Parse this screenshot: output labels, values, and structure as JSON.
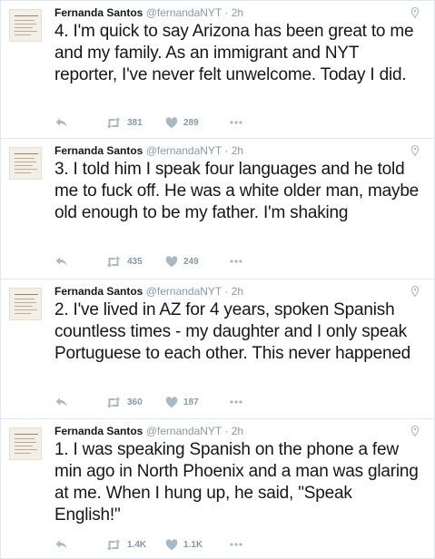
{
  "tweets": [
    {
      "name": "Fernanda Santos",
      "handle": "@fernandaNYT",
      "time": "· 2h",
      "text": "4. I'm quick to say Arizona has been great to me and my family. As an immigrant and NYT reporter, I've never felt unwelcome. Today I did.",
      "retweets": "381",
      "likes": "289"
    },
    {
      "name": "Fernanda Santos",
      "handle": "@fernandaNYT",
      "time": "· 2h",
      "text": "3. I told him I speak four languages and he told me to fuck off. He was a white older man, maybe old enough to be my father. I'm shaking",
      "retweets": "435",
      "likes": "249"
    },
    {
      "name": "Fernanda Santos",
      "handle": "@fernandaNYT",
      "time": "· 2h",
      "text": "2. I've lived in AZ for 4 years, spoken Spanish countless times - my daughter and I only speak Portuguese to each other. This never happened",
      "retweets": "360",
      "likes": "187"
    },
    {
      "name": "Fernanda Santos",
      "handle": "@fernandaNYT",
      "time": "· 2h",
      "text": "1. I was speaking Spanish on the phone a few min ago in North Phoenix and a man was glaring at me. When I hung up, he said, \"Speak English!\"",
      "retweets": "1.4K",
      "likes": "1.1K"
    }
  ],
  "icons": {
    "reply": "reply-icon",
    "retweet": "retweet-icon",
    "like": "heart-icon",
    "more": "more-icon",
    "caret": "location-pin-icon"
  },
  "colors": {
    "text": "#14171a",
    "muted": "#8899a6",
    "border": "#e1e8ed"
  }
}
